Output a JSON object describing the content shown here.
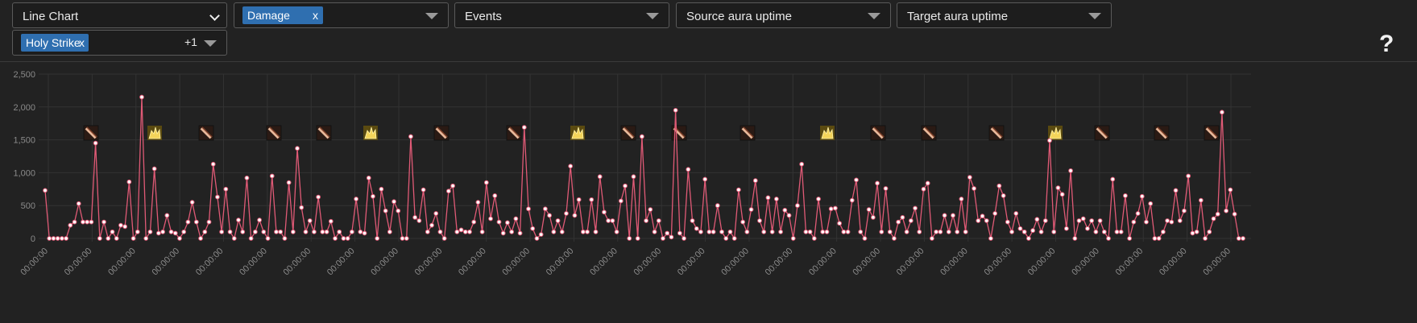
{
  "controls": {
    "chart_type": "Line Chart",
    "metric_tag": "Damage",
    "events": "Events",
    "source_aura": "Source aura uptime",
    "target_aura": "Target aura uptime",
    "ability_tag": "Holy Strike",
    "ability_more": "+1",
    "tag_remove": "x",
    "help": "?"
  },
  "colors": {
    "line": "#e05a76",
    "point_fill": "#ffffff",
    "grid": "#333333",
    "tick_text": "#8a8a8a",
    "tag_bg": "#2f6fb0"
  },
  "chart_data": {
    "type": "line",
    "ylim": [
      0,
      2500
    ],
    "yticks": [
      "2,500",
      "2,000",
      "1,500",
      "1,000",
      "500",
      "0"
    ],
    "xtick_label": "00:00:00",
    "xtick_count": 28,
    "grid": true,
    "series": [
      {
        "values": [
          730,
          0,
          0,
          0,
          0,
          0,
          200,
          250,
          530,
          250,
          250,
          250,
          1450,
          0,
          250,
          0,
          100,
          0,
          200,
          180,
          860,
          0,
          100,
          2150,
          0,
          100,
          1060,
          80,
          100,
          350,
          100,
          80,
          0,
          100,
          250,
          550,
          250,
          0,
          100,
          250,
          1130,
          630,
          100,
          750,
          100,
          0,
          280,
          100,
          920,
          0,
          100,
          280,
          100,
          0,
          950,
          100,
          100,
          0,
          850,
          100,
          1370,
          470,
          100,
          270,
          100,
          630,
          100,
          100,
          260,
          0,
          100,
          0,
          0,
          100,
          600,
          100,
          80,
          920,
          640,
          0,
          750,
          420,
          100,
          560,
          420,
          0,
          0,
          1550,
          320,
          270,
          740,
          100,
          200,
          380,
          100,
          0,
          720,
          800,
          100,
          130,
          100,
          100,
          250,
          550,
          100,
          850,
          300,
          650,
          250,
          80,
          240,
          100,
          300,
          80,
          1690,
          450,
          150,
          0,
          60,
          450,
          350,
          100,
          270,
          100,
          380,
          1100,
          350,
          590,
          100,
          100,
          590,
          100,
          940,
          400,
          270,
          270,
          100,
          570,
          800,
          0,
          940,
          0,
          1550,
          270,
          440,
          100,
          270,
          0,
          80,
          20,
          1950,
          80,
          0,
          1050,
          270,
          150,
          100,
          900,
          100,
          100,
          500,
          100,
          0,
          100,
          0,
          740,
          250,
          100,
          440,
          880,
          270,
          100,
          620,
          100,
          600,
          100,
          430,
          350,
          0,
          500,
          1130,
          100,
          100,
          0,
          600,
          100,
          100,
          450,
          460,
          230,
          100,
          100,
          580,
          890,
          100,
          0,
          440,
          320,
          840,
          100,
          760,
          100,
          0,
          250,
          320,
          100,
          270,
          460,
          100,
          750,
          840,
          0,
          100,
          100,
          350,
          100,
          350,
          100,
          600,
          100,
          930,
          760,
          270,
          340,
          270,
          0,
          380,
          800,
          650,
          250,
          100,
          380,
          150,
          100,
          0,
          120,
          290,
          100,
          270,
          1490,
          100,
          770,
          670,
          150,
          1030,
          0,
          270,
          300,
          150,
          270,
          100,
          270,
          100,
          0,
          900,
          100,
          100,
          650,
          0,
          250,
          380,
          640,
          250,
          530,
          0,
          0,
          100,
          270,
          250,
          730,
          270,
          420,
          950,
          80,
          100,
          580,
          0,
          100,
          300,
          370,
          1920,
          420,
          740,
          370,
          0,
          0
        ]
      }
    ],
    "event_markers": [
      {
        "x": 113,
        "kind": "sword"
      },
      {
        "x": 192,
        "kind": "wings"
      },
      {
        "x": 256,
        "kind": "sword"
      },
      {
        "x": 340,
        "kind": "sword"
      },
      {
        "x": 402,
        "kind": "sword"
      },
      {
        "x": 460,
        "kind": "wings"
      },
      {
        "x": 548,
        "kind": "sword"
      },
      {
        "x": 638,
        "kind": "sword"
      },
      {
        "x": 717,
        "kind": "wings"
      },
      {
        "x": 780,
        "kind": "sword"
      },
      {
        "x": 843,
        "kind": "sword"
      },
      {
        "x": 928,
        "kind": "sword"
      },
      {
        "x": 1027,
        "kind": "wings"
      },
      {
        "x": 1090,
        "kind": "sword"
      },
      {
        "x": 1153,
        "kind": "sword"
      },
      {
        "x": 1237,
        "kind": "sword"
      },
      {
        "x": 1310,
        "kind": "wings"
      },
      {
        "x": 1368,
        "kind": "sword"
      },
      {
        "x": 1442,
        "kind": "sword"
      },
      {
        "x": 1504,
        "kind": "sword"
      }
    ]
  }
}
